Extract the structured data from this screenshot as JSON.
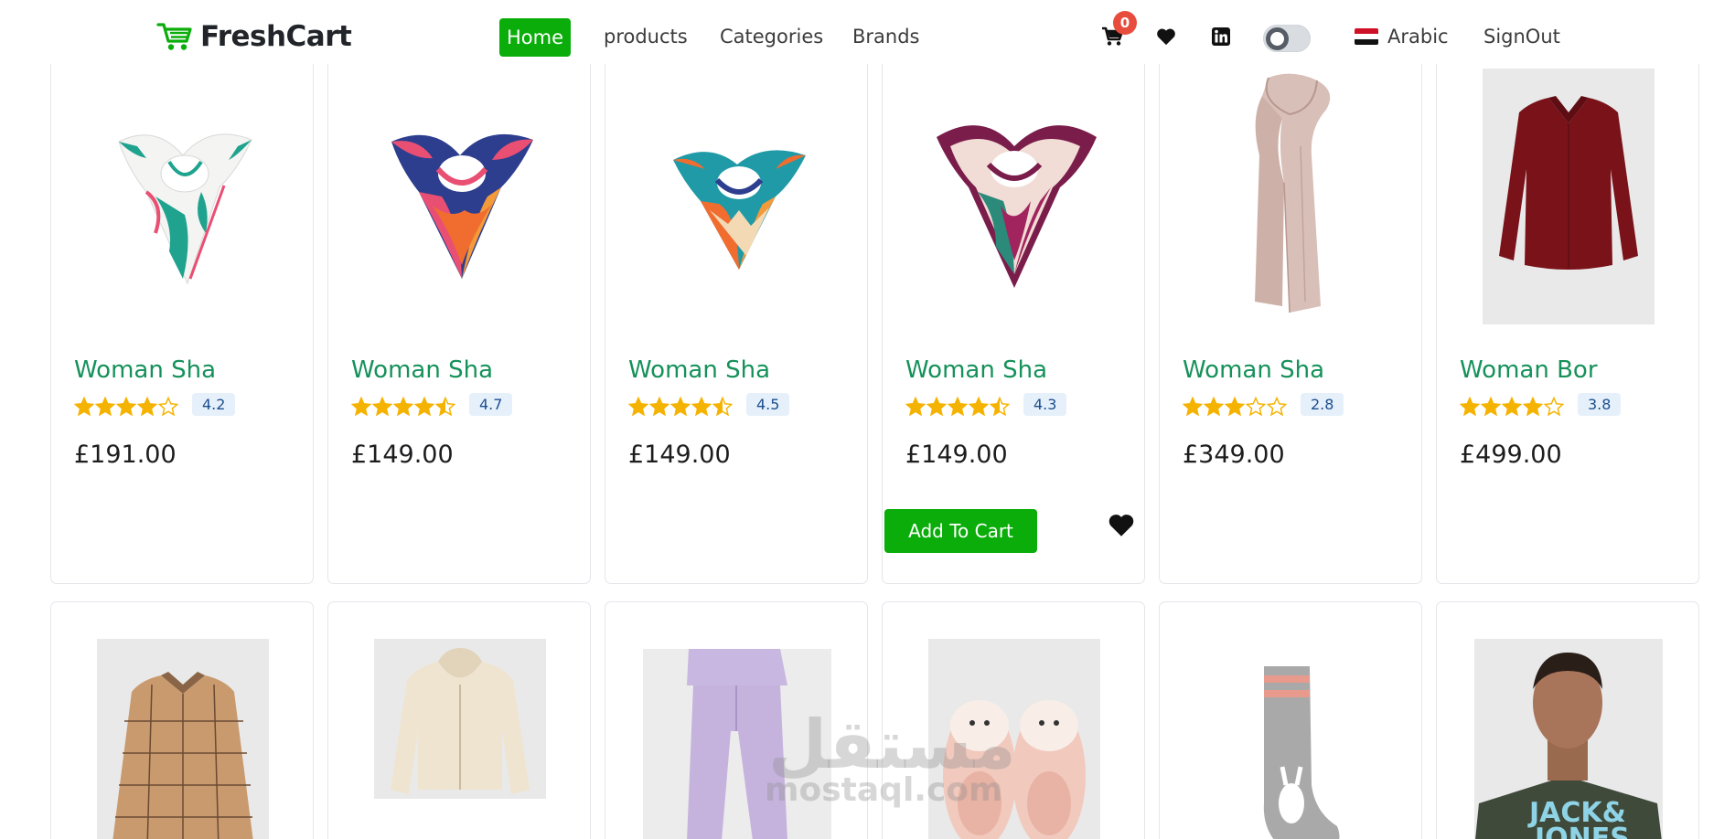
{
  "navbar": {
    "brand": "FreshCart",
    "links": [
      {
        "label": "Home"
      },
      {
        "label": "products"
      },
      {
        "label": "Categories"
      },
      {
        "label": "Brands"
      }
    ],
    "cart_count": "0",
    "language": "Arabic",
    "signout": "SignOut"
  },
  "colors": {
    "accent": "#0aad0a",
    "title_green": "#16915a",
    "badge_red": "#e74c3c",
    "star_gold": "#f5b301"
  },
  "products_row1": [
    {
      "title": "Woman Sha",
      "rating": "4.2",
      "stars": 4.2,
      "price": "£191.00"
    },
    {
      "title": "Woman Sha",
      "rating": "4.7",
      "stars": 4.7,
      "price": "£149.00"
    },
    {
      "title": "Woman Sha",
      "rating": "4.5",
      "stars": 4.5,
      "price": "£149.00"
    },
    {
      "title": "Woman Sha",
      "rating": "4.3",
      "stars": 4.3,
      "price": "£149.00",
      "hovered": true
    },
    {
      "title": "Woman Sha",
      "rating": "2.8",
      "stars": 2.8,
      "price": "£349.00"
    },
    {
      "title": "Woman Bor",
      "rating": "3.8",
      "stars": 3.8,
      "price": "£499.00"
    }
  ],
  "add_to_cart_label": "Add To Cart",
  "watermark": {
    "arabic": "مستقل",
    "latin": "mostaql.com"
  }
}
